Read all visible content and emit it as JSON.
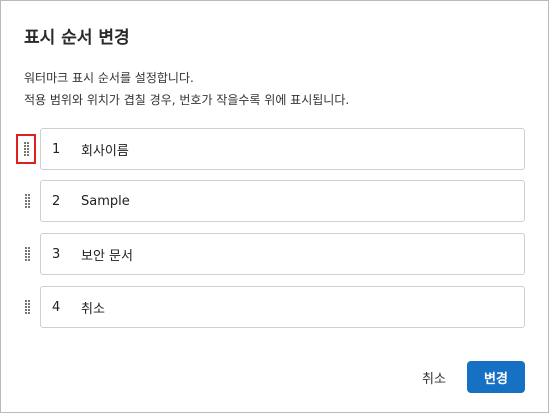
{
  "dialog": {
    "title": "표시 순서 변경",
    "description_line1": "워터마크 표시 순서를 설정합니다.",
    "description_line2": "적용 범위와 위치가 겹칠 경우, 번호가 작을수록 위에 표시됩니다."
  },
  "items": [
    {
      "number": "1",
      "label": "회사이름"
    },
    {
      "number": "2",
      "label": "Sample"
    },
    {
      "number": "3",
      "label": "보안 문서"
    },
    {
      "number": "4",
      "label": "취소"
    }
  ],
  "buttons": {
    "cancel_label": "취소",
    "confirm_label": "변경"
  },
  "colors": {
    "primary": "#1671c4",
    "highlight_border": "#e02020"
  },
  "icons": {
    "drag_handle": "drag-handle-icon"
  }
}
